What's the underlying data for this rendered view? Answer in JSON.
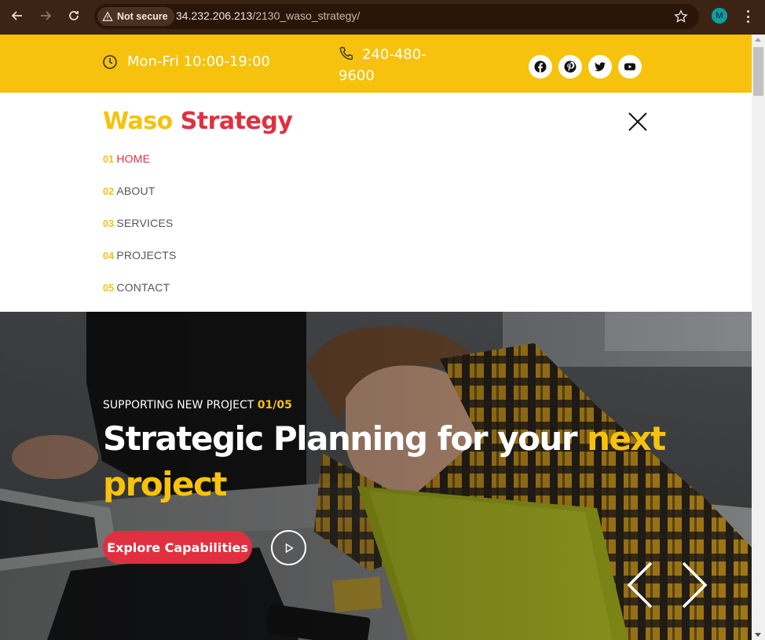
{
  "browser": {
    "security_label": "Not secure",
    "url_host": "34.232.206.213",
    "url_path": "/2130_waso_strategy/",
    "profile_initial": "M"
  },
  "topbar": {
    "hours": "Mon-Fri 10:00-19:00",
    "phone": "240-480-9600",
    "socials": [
      "facebook-icon",
      "pinterest-icon",
      "twitter-icon",
      "youtube-icon"
    ],
    "bg_color": "#f6c20d"
  },
  "brand": {
    "word1": "Waso",
    "word2": "Strategy",
    "accent_yellow": "#f6c20d",
    "accent_red": "#e0303f"
  },
  "menu": {
    "items": [
      {
        "num": "01",
        "label": "HOME",
        "active": true
      },
      {
        "num": "02",
        "label": "ABOUT",
        "active": false
      },
      {
        "num": "03",
        "label": "SERVICES",
        "active": false
      },
      {
        "num": "04",
        "label": "PROJECTS",
        "active": false
      },
      {
        "num": "05",
        "label": "CONTACT",
        "active": false
      }
    ]
  },
  "hero": {
    "kicker": "SUPPORTING NEW PROJECT",
    "counter": "01/05",
    "title_main": "Strategic Planning for your",
    "title_highlight": "next project",
    "cta_label": "Explore Capabilities"
  }
}
